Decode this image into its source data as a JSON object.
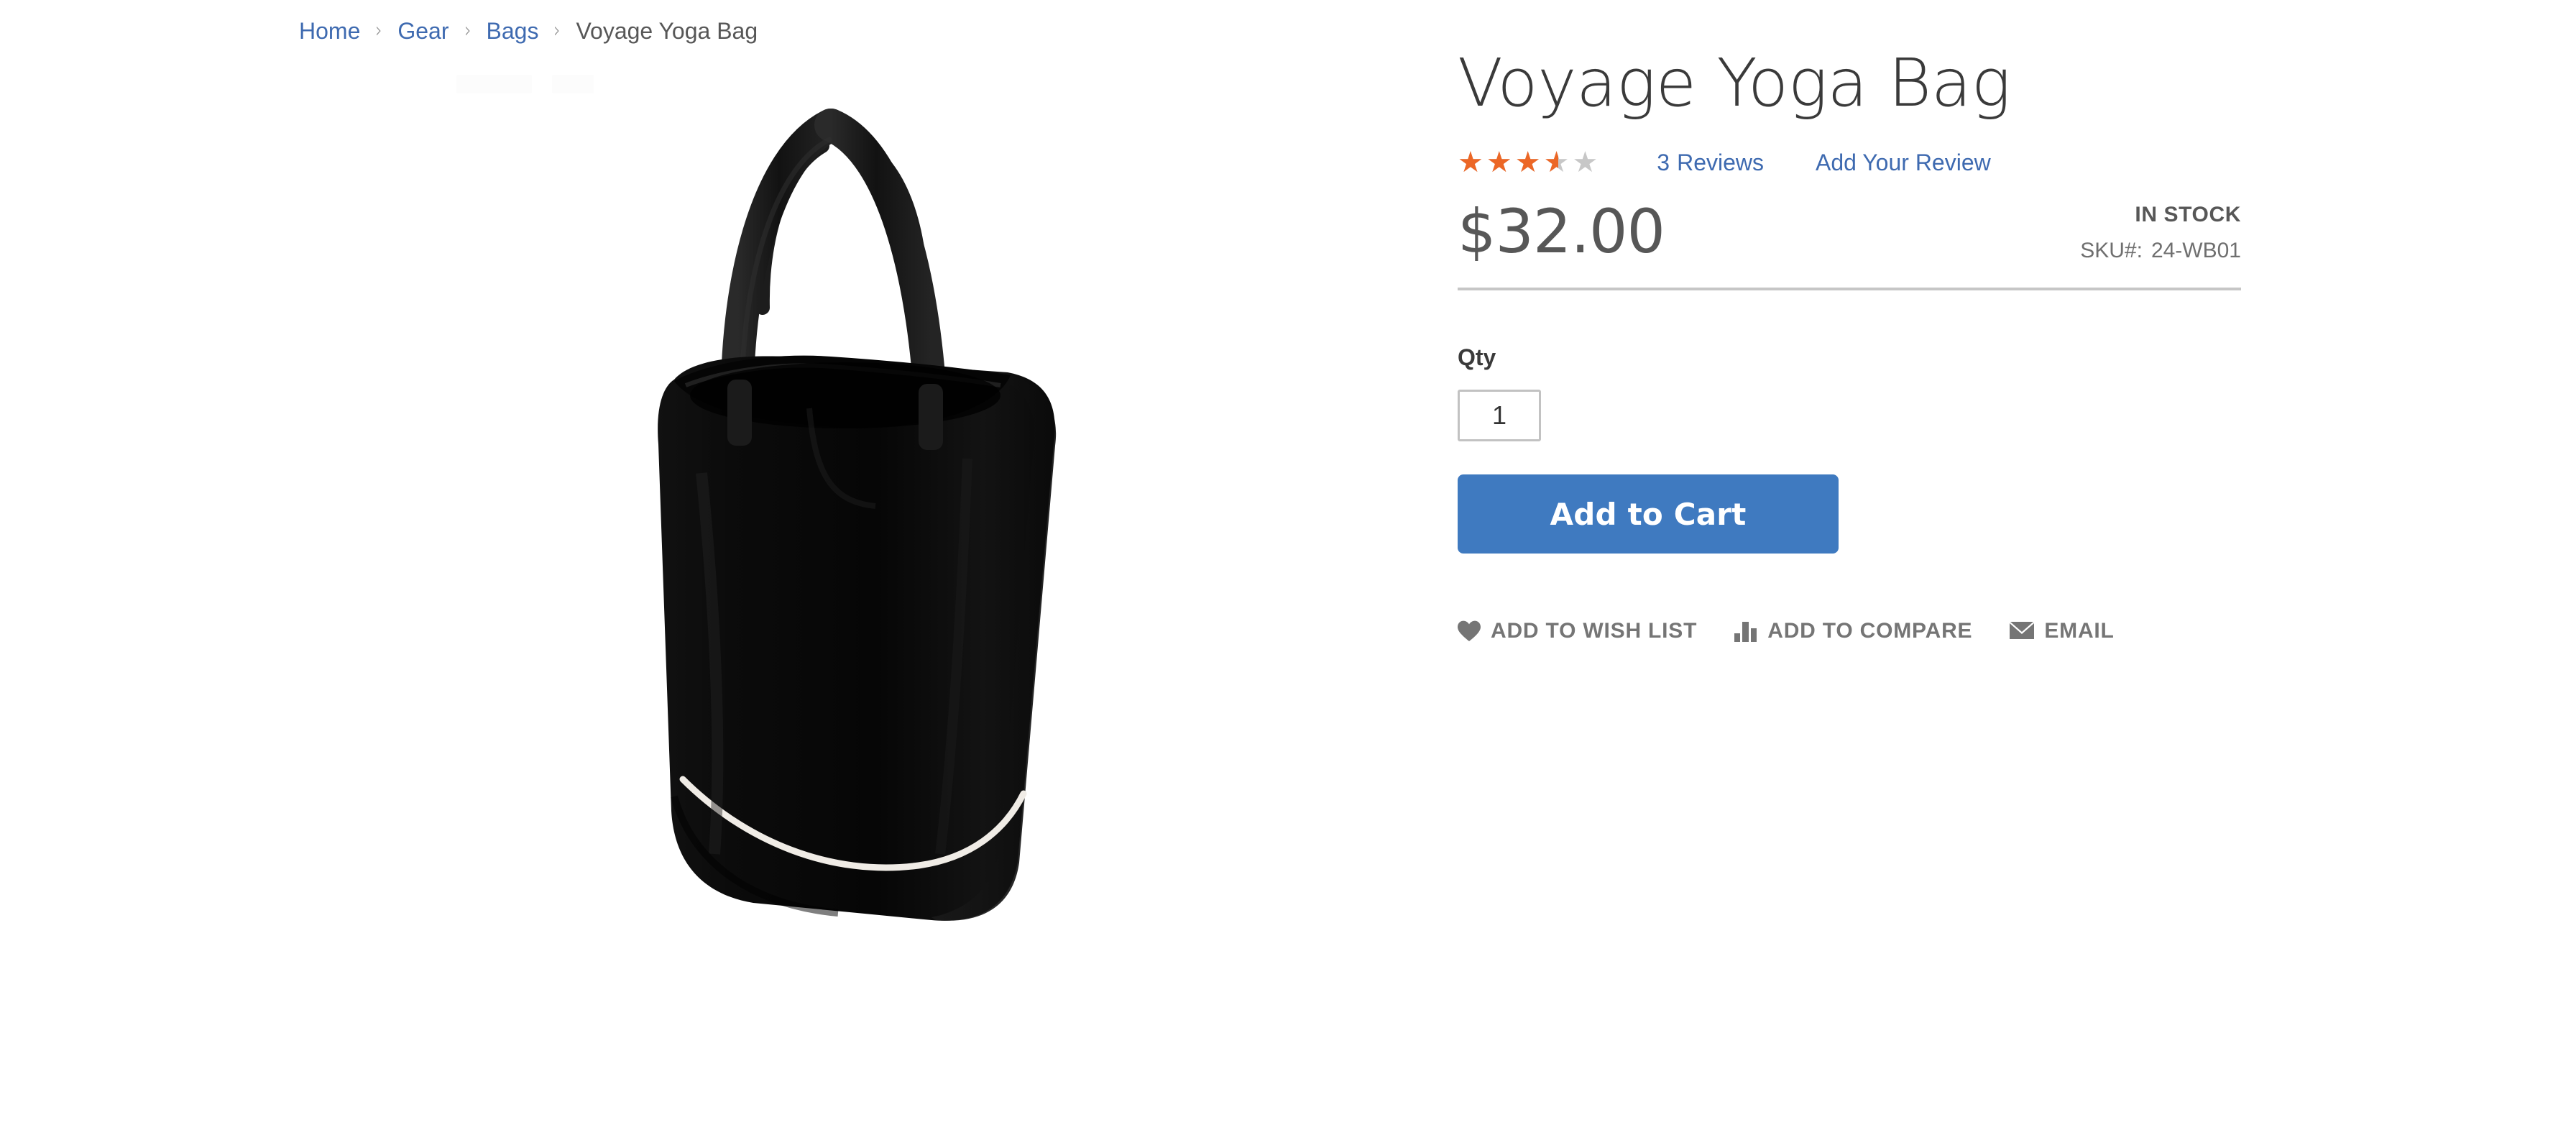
{
  "breadcrumbs": {
    "separator": "›",
    "items": [
      {
        "label": "Home",
        "current": false
      },
      {
        "label": "Gear",
        "current": false
      },
      {
        "label": "Bags",
        "current": false
      },
      {
        "label": "Voyage Yoga Bag",
        "current": true
      }
    ]
  },
  "product": {
    "title": "Voyage Yoga Bag",
    "price": "$32.00",
    "stock_status": "IN STOCK",
    "sku_label": "SKU#:",
    "sku_value": "24-WB01",
    "image_alt": "Voyage Yoga Bag"
  },
  "rating": {
    "stars_glyphs": "★★★★★",
    "percent": 70,
    "value": 3.5,
    "max": 5,
    "filled_color": "#ec6726",
    "empty_color": "#c7c7c7",
    "reviews_count": "3",
    "reviews_label": "Reviews",
    "add_review_label": "Add Your Review"
  },
  "purchase": {
    "qty_label": "Qty",
    "qty_value": "1",
    "qty_placeholder": "1",
    "add_to_cart_label": "Add to Cart",
    "add_to_cart_color": "#3f7ac0"
  },
  "actions": [
    {
      "label": "Add to Wish List",
      "icon": "heart-icon"
    },
    {
      "label": "Add to Compare",
      "icon": "bar-chart-icon"
    },
    {
      "label": "Email",
      "icon": "envelope-icon"
    }
  ],
  "colors": {
    "link": "#3e6ab0",
    "text": "#575757",
    "divider": "#c6c6c6",
    "accent": "#ec6726"
  }
}
